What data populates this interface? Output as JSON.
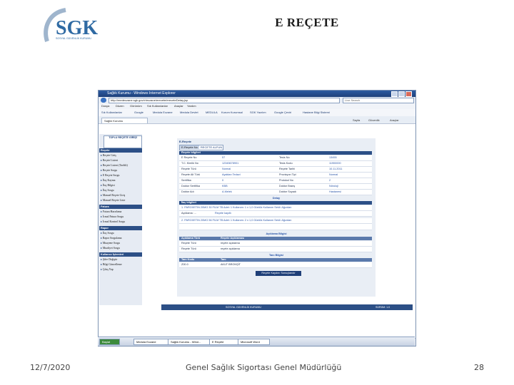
{
  "slide": {
    "title": "E REÇETE",
    "logo_text": "SGK",
    "logo_subtext": "SOSYAL GÜVENLİK KURUMU",
    "footer_date": "12/7/2020",
    "footer_org": "Genel Sağlık Sigortası Genel Müdürlüğü",
    "page_number": "28"
  },
  "browser": {
    "title": "Sağlık Kurumu - Windows Internet Explorer",
    "address": "http://medeczane.sgk.gov.tr/eczane/erecete/ereceteDetay.jsp",
    "search_placeholder": "Live Search",
    "menu": [
      "Dosya",
      "Düzen",
      "Görünüm",
      "Sık Kullanılanlar",
      "Araçlar",
      "Yardım"
    ],
    "favorites": [
      "Sık Kullanılanlar",
      "Google",
      "Medula Eczane",
      "Medula Devlet",
      "MEDULA",
      "Kurum Kurumsal",
      "SGK Yazılım",
      "Google Çeviri",
      "Hastane Bilgi Sistemi"
    ],
    "tab_label": "Sağlık Kurumu",
    "tab_tools": [
      "Sayfa",
      "Güvenlik",
      "Araçlar"
    ]
  },
  "sidebar": {
    "header": "TOPLU REÇETE GİRİŞİ",
    "sections": [
      {
        "title": "Reçete",
        "items": [
          "Reçete Giriş",
          "Reçete Listesi",
          "Reçete Listesi (Tarihli)",
          "Reçete Sorgu",
          "E Reçete Sorgu",
          "İlaç Kayma",
          "İlaç Bilgisi",
          "İlaç Sorgu",
          "Manuel Reçete Giriş",
          "Manuel Reçete Liste"
        ]
      },
      {
        "title": "Fatura",
        "items": [
          "Fatura Hazırlama",
          "İcmal Fatura Sorgu",
          "İcmal Kontrol Sorgu"
        ]
      },
      {
        "title": "Rapor",
        "items": [
          "İlaç Sorgu",
          "Rapor Sorgulama",
          "Muayene Sorgu",
          "Muafiyet Sorgu"
        ]
      },
      {
        "title": "Kullanıcı İşlemleri",
        "items": [
          "Şifre Değiştir",
          "Bilgi Güncelleme",
          "Çıkış Yap"
        ]
      }
    ]
  },
  "prescription": {
    "panel_title": "E-Reçete",
    "code_label": "E-Reçete No",
    "code_value": "RECETE ALFUN",
    "info_header": "Reçete bilgileri",
    "rows": [
      {
        "k1": "E Reçete No",
        "v1": "57",
        "k2": "Tesis No",
        "v2": "13455"
      },
      {
        "k1": "T.C. Kimlik No",
        "v1": "12345678901",
        "k2": "Tesis Kodu",
        "v2": "11900000"
      },
      {
        "k1": "Reçete Türü",
        "v1": "Normal",
        "k2": "Reçete Tarihi",
        "v2": "10.11.2011"
      },
      {
        "k1": "Reçete Alt Türü",
        "v1": "Ayaktan Tedavi",
        "k2": "Provizyon Tipi",
        "v2": "Normal"
      },
      {
        "k1": "Sertifika",
        "v1": "0",
        "k2": "Protokol No",
        "v2": "2"
      },
      {
        "k1": "Doktor Sertifika",
        "v1": "KBB",
        "k2": "Doktor Branş",
        "v2": "Nöroloji"
      },
      {
        "k1": "Doktor Adı",
        "v1": "A.Melek",
        "k2": "Doktor Soyadı",
        "v2": "Hastanesi"
      }
    ],
    "drug_header": "İlaç bilgileri",
    "drug_detail": "Detay",
    "drugs": [
      "1. PAROXETIN 20MG 30 FILM TB Adet: 1 Kullanım: 1 x 1,0 Günlük Kullanım Sekli: Ağızdan",
      "2. PAROXETIN 20MG 56 FILM TB Adet: 1 Kullanım: 2 x 1,0 Günlük Kullanım Sekli: Ağızdan"
    ],
    "desc_label": "Açıklama: ...",
    "desc_value": "Reçete kayıtlı",
    "diag_header": "Açıklama Bilgisi",
    "diag_cols": [
      "Açıklama Türü",
      "Reçete Açıklaması"
    ],
    "diag_rows": [
      [
        "Reçete Türü",
        "reçete açıklama"
      ],
      [
        "Reçete Türü",
        "reçete açıklama"
      ]
    ],
    "tani_header": "Tanı Bilgisi",
    "tani_cols": [
      "Tanı Kodu",
      "Tanı"
    ],
    "tani_row": [
      "Z00.0",
      "AKUT BRONŞİT"
    ],
    "save_button": "Reçete Kaydını Sonuçlandır",
    "footer_left": "SOSYAL GÜVENLİK KURUMU",
    "footer_right": "SÜRÜM: 1.0"
  },
  "taskbar": {
    "items": [
      "Başlat",
      "Medula Eczane",
      "Sağlık Kurumu - Wind...",
      "E Reçete",
      "Microsoft Word"
    ]
  }
}
